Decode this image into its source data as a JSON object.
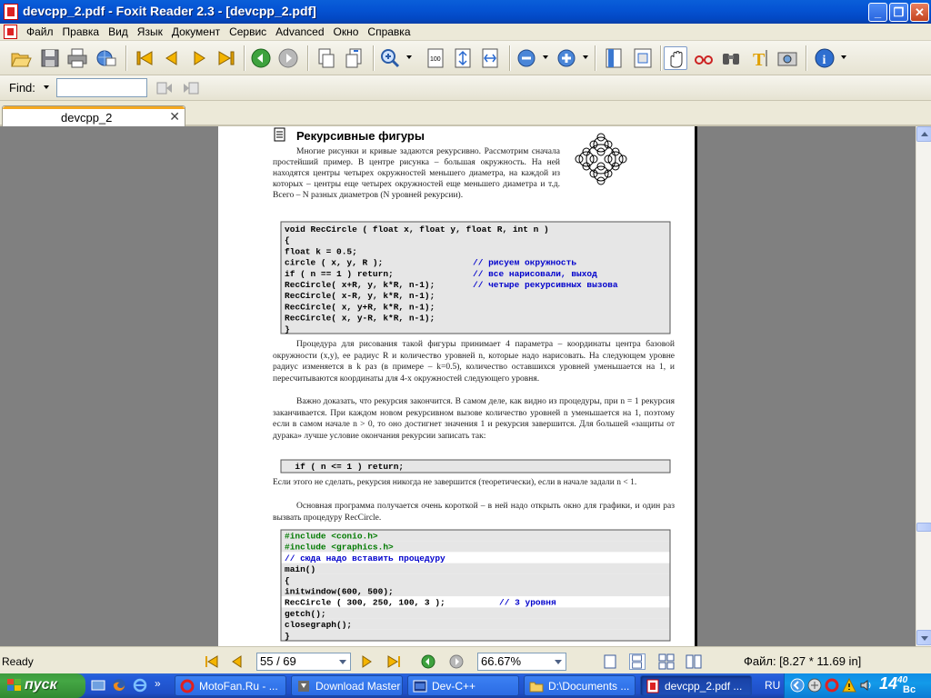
{
  "window": {
    "title": "devcpp_2.pdf - Foxit Reader 2.3 - [devcpp_2.pdf]",
    "minimize_label": "_",
    "maximize_label": "❐",
    "close_label": "✕"
  },
  "menubar": {
    "items": [
      "Файл",
      "Правка",
      "Вид",
      "Язык",
      "Документ",
      "Сервис",
      "Advanced",
      "Окно",
      "Справка"
    ]
  },
  "toolbar": {
    "icons": [
      "open-icon",
      "save-icon",
      "print-icon",
      "email-icon",
      "first-page-icon",
      "previous-page-icon",
      "next-page-icon",
      "last-page-icon",
      "go-back-icon",
      "go-forward-icon",
      "rotate-left-icon",
      "rotate-right-icon",
      "zoom-tool-icon",
      "actual-size-icon",
      "fit-page-icon",
      "fit-width-icon",
      "zoom-out-icon",
      "zoom-in-icon",
      "bookmark-icon",
      "fit-visible-icon",
      "hand-tool-icon",
      "text-viewer-icon",
      "find-icon",
      "text-select-icon",
      "snapshot-icon",
      "info-icon"
    ]
  },
  "findbar": {
    "label": "Find:",
    "value": ""
  },
  "tab": {
    "label": "devcpp_2",
    "close": "✕"
  },
  "document": {
    "heading": "Рекурсивные фигуры",
    "paragraphs": [
      "Многие рисунки и кривые задаются рекурсивно. Рассмотрим сначала простейший пример. В центре рисунка – большая окружность. На ней находятся центры четырех окружностей меньшего диаметра, на каждой из которых – центры еще четырех окружностей еще меньшего диаметра и т.д. Всего – N разных диаметров (N уровней рекурсии).",
      "Процедура для рисования такой фигуры принимает 4 параметра – координаты центра базовой окружности (x,y), ее радиус R и количество уровней n, которые надо нарисовать. На следующем уровне радиус изменяется в k раз (в примере – k=0.5), количество оставшихся уровней уменьшается на 1, и пересчитываются координаты для 4-х окружностей следующего уровня.",
      "Важно доказать, что рекурсия закончится. В самом деле, как видно из процедуры, при n = 1 рекурсия заканчивается. При каждом новом рекурсивном вызове количество уровней n уменьшается на 1, поэтому если в самом начале n > 0, то оно достигнет значения 1 и рекурсия завершится. Для большей «защиты от дурака» лучше условие окончания рекурсии записать так:",
      "Если этого не сделать, рекурсия никогда не завершится (теоретически), если в начале задали n < 1.",
      "Основная программа получается очень короткой – в ней надо открыть окно для графики, и один раз вызвать процедуру RecCircle."
    ],
    "code1": [
      {
        "code": "void RecCircle ( float x, float y, float R, int n )",
        "comment": ""
      },
      {
        "code": "{",
        "comment": ""
      },
      {
        "code": "  float k = 0.5;",
        "comment": ""
      },
      {
        "code": "  circle ( x, y, R );",
        "comment": "// рисуем окружность"
      },
      {
        "code": "  if ( n == 1 ) return;",
        "comment": "// все нарисовали, выход"
      },
      {
        "code": "  RecCircle( x+R, y, k*R, n-1);",
        "comment": "// четыре рекурсивных вызова"
      },
      {
        "code": "  RecCircle( x-R, y, k*R, n-1);",
        "comment": ""
      },
      {
        "code": "  RecCircle( x, y+R, k*R, n-1);",
        "comment": ""
      },
      {
        "code": "  RecCircle( x, y-R, k*R, n-1);",
        "comment": ""
      },
      {
        "code": "}",
        "comment": ""
      }
    ],
    "code2": "  if ( n <= 1 ) return;",
    "code3": [
      {
        "text": "  #include <conio.h>",
        "kind": "directive",
        "bg": "gray"
      },
      {
        "text": "  #include <graphics.h>",
        "kind": "directive",
        "bg": "gray"
      },
      {
        "text": "    // сюда надо вставить процедуру",
        "kind": "comment",
        "bg": "white"
      },
      {
        "text": "  main()",
        "kind": "plain",
        "bg": "gray"
      },
      {
        "text": "  {",
        "kind": "plain",
        "bg": "gray"
      },
      {
        "text": "    initwindow(600, 500);",
        "kind": "plain",
        "bg": "gray"
      },
      {
        "text": "    RecCircle ( 300, 250, 100, 3 );",
        "kind": "plain",
        "bg": "white",
        "comment": "// 3 уровня"
      },
      {
        "text": "    getch();",
        "kind": "plain",
        "bg": "gray"
      },
      {
        "text": "    closegraph();",
        "kind": "plain",
        "bg": "gray"
      },
      {
        "text": "  }",
        "kind": "plain",
        "bg": "gray"
      }
    ]
  },
  "statusbar": {
    "ready": "Ready",
    "page": "55 / 69",
    "zoom": "66.67%",
    "file_size": "Файл: [8.27 * 11.69 in]"
  },
  "taskbar": {
    "start": "пуск",
    "tasks": [
      {
        "label": "MotoFan.Ru - ...",
        "active": false
      },
      {
        "label": "Download Master",
        "active": false
      },
      {
        "label": "Dev-C++",
        "active": false
      },
      {
        "label": "D:\\Documents ...",
        "active": false
      },
      {
        "label": "devcpp_2.pdf ...",
        "active": true
      }
    ],
    "lang": "RU",
    "time": "14",
    "time_min": "40",
    "day": "Вс"
  },
  "colors": {
    "titlebar": "#0553d3",
    "code_comment": "#0000cc",
    "code_directive": "#007a00"
  }
}
